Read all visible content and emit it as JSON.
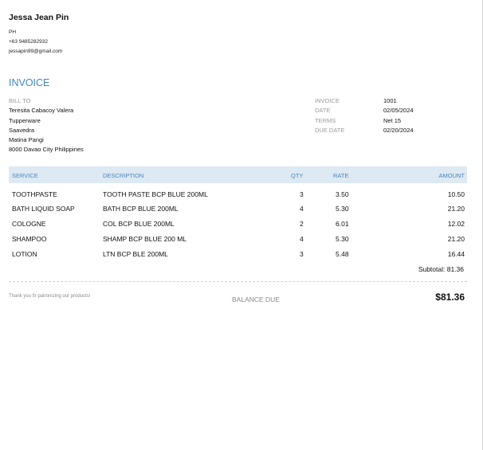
{
  "sender": {
    "name": "Jessa Jean Pin",
    "country": "PH",
    "phone": "+63 9485282932",
    "email": "jessapin99@gmail.com"
  },
  "invoice_title": "INVOICE",
  "bill_to": {
    "label": "BILL TO",
    "lines": [
      "Teresita Cabacoy Valera",
      "Tupperware",
      "Saavedra",
      "Matina Pangi",
      "8000 Davao City Philippines"
    ]
  },
  "meta": [
    {
      "label": "INVOICE",
      "value": "1001"
    },
    {
      "label": "DATE",
      "value": "02/05/2024"
    },
    {
      "label": "TERMS",
      "value": "Net 15"
    },
    {
      "label": "DUE DATE",
      "value": "02/20/2024"
    }
  ],
  "table": {
    "headers": {
      "service": "SERVICE",
      "description": "DESCRIPTION",
      "qty": "QTY",
      "rate": "RATE",
      "amount": "AMOUNT"
    },
    "rows": [
      {
        "service": "TOOTHPASTE",
        "description": "TOOTH PASTE BCP BLUE 200ML",
        "qty": "3",
        "rate": "3.50",
        "amount": "10.50"
      },
      {
        "service": "BATH LIQUID SOAP",
        "description": "BATH BCP BLUE 200ML",
        "qty": "4",
        "rate": "5.30",
        "amount": "21.20"
      },
      {
        "service": "COLOGNE",
        "description": "COL BCP BLUE 200ML",
        "qty": "2",
        "rate": "6.01",
        "amount": "12.02"
      },
      {
        "service": "SHAMPOO",
        "description": "SHAMP BCP BLUE 200 ML",
        "qty": "4",
        "rate": "5.30",
        "amount": "21.20"
      },
      {
        "service": "LOTION",
        "description": "LTN BCP BLE 200ML",
        "qty": "3",
        "rate": "5.48",
        "amount": "16.44"
      }
    ]
  },
  "subtotal": "Subtotal:  81.36",
  "footer": {
    "note": "Thank you fir patronizing our products!",
    "balance_label": "BALANCE DUE",
    "balance_value": "$81.36"
  },
  "colors": {
    "accent": "#3f86c2",
    "header_bg": "#dde9f3",
    "muted": "#9a9a9a"
  }
}
